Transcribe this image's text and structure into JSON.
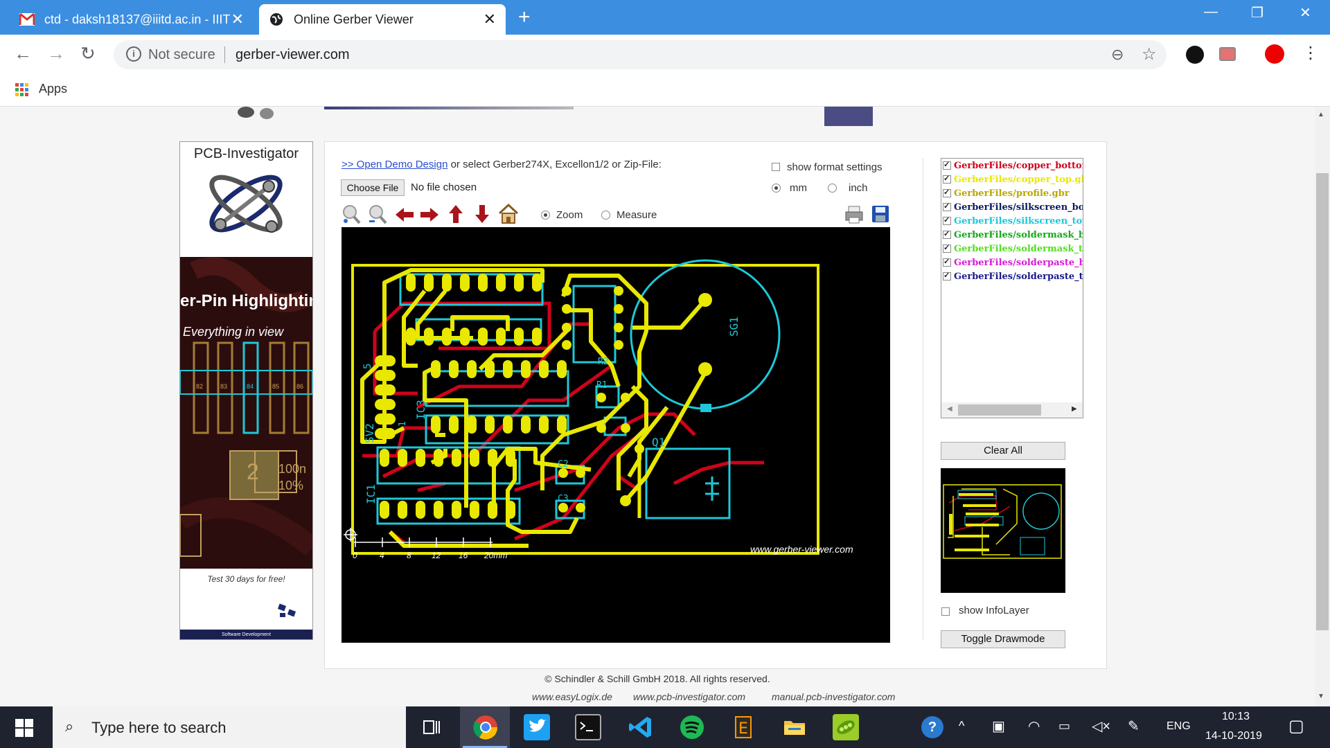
{
  "tabs": [
    {
      "title": "ctd - daksh18137@iiitd.ac.in - IIIT",
      "icon": "gmail-icon"
    },
    {
      "title": "Online Gerber Viewer",
      "icon": "globe-icon"
    }
  ],
  "address": {
    "security": "Not secure",
    "url": "gerber-viewer.com"
  },
  "bookmarks": {
    "apps": "Apps"
  },
  "ad": {
    "brand": "PCB-Investigator",
    "headline": "er-Pin Highlightin",
    "tagline": "Everything in view",
    "pins": [
      "82",
      "83",
      "84",
      "85",
      "86"
    ],
    "part_number": "2",
    "part_value1": "100n",
    "part_value2": "10%",
    "trial": "Test 30 days for free!",
    "company": "Software Development"
  },
  "viewer": {
    "demo_link": ">> Open Demo Design",
    "select_text": " or select Gerber274X, Excellon1/2 or Zip-File:",
    "choose_file": "Choose File",
    "no_file": "No file chosen",
    "show_format": "show format settings",
    "unit_mm": "mm",
    "unit_inch": "inch",
    "mode_zoom": "Zoom",
    "mode_measure": "Measure",
    "scale_labels": [
      "0",
      "4",
      "8",
      "12",
      "16",
      "20mm"
    ],
    "watermark": "www.gerber-viewer.com",
    "refdes": {
      "sg1": "SG1",
      "sv2": "SV2",
      "ic3": "IC3",
      "ic1": "IC1",
      "q1": "Q1",
      "r1": "R1",
      "r2": "R2",
      "c2": "C2",
      "c3": "C3",
      "pin5": "5",
      "pin1": "1"
    }
  },
  "layers": [
    {
      "name": "GerberFiles/copper_bottom",
      "color": "#d0021b"
    },
    {
      "name": "GerberFiles/copper_top.gbr",
      "color": "#e8e800"
    },
    {
      "name": "GerberFiles/profile.gbr",
      "color": "#b8a800"
    },
    {
      "name": "GerberFiles/silkscreen_bott",
      "color": "#0b1a5e"
    },
    {
      "name": "GerberFiles/silkscreen_top.",
      "color": "#1ec8d8"
    },
    {
      "name": "GerberFiles/soldermask_bo",
      "color": "#17a81a"
    },
    {
      "name": "GerberFiles/soldermask_top",
      "color": "#55dd22"
    },
    {
      "name": "GerberFiles/solderpaste_bo",
      "color": "#d81bd8"
    },
    {
      "name": "GerberFiles/solderpaste_top",
      "color": "#1a1a8c"
    }
  ],
  "controls": {
    "clear_all": "Clear All",
    "show_infolayer": "show InfoLayer",
    "toggle_drawmode": "Toggle Drawmode"
  },
  "footer": {
    "copyright": "© Schindler & Schill GmbH 2018. All rights reserved.",
    "links": [
      "www.easyLogix.de",
      "www.pcb-investigator.com",
      "manual.pcb-investigator.com"
    ]
  },
  "taskbar": {
    "search": "Type here to search",
    "lang": "ENG",
    "time": "10:13",
    "date": "14-10-2019"
  }
}
